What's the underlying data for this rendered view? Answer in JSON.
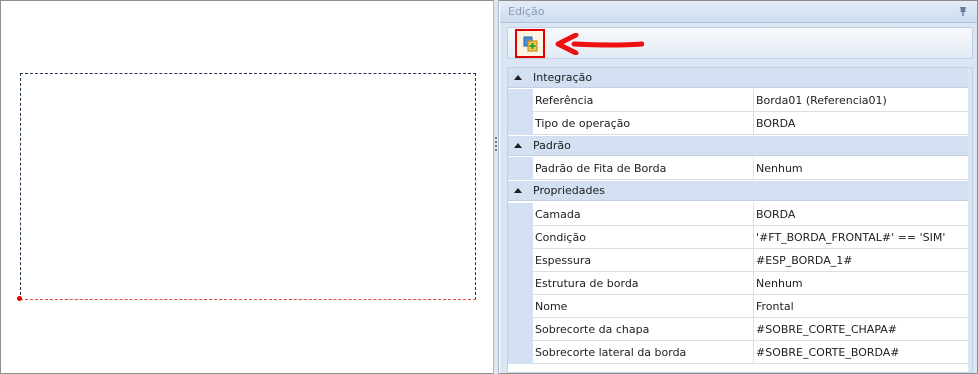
{
  "panel": {
    "title": "Edição",
    "pin_icon": "pin-icon",
    "toolbar": {
      "add_icon": "add-layer-icon"
    }
  },
  "colors": {
    "highlight": "#e00000",
    "category_bg": "#d3e0f1",
    "panel_bg": "#dbe6f4",
    "rect_outline": "#1f3550"
  },
  "properties": {
    "categories": [
      {
        "label": "Integração",
        "rows": [
          {
            "name": "Referência",
            "value": "Borda01 (Referencia01)"
          },
          {
            "name": "Tipo de operação",
            "value": "BORDA"
          }
        ]
      },
      {
        "label": "Padrão",
        "rows": [
          {
            "name": "Padrão de Fita de Borda",
            "value": "Nenhum"
          }
        ]
      },
      {
        "label": "Propriedades",
        "rows": [
          {
            "name": "Camada",
            "value": "BORDA"
          },
          {
            "name": "Condição",
            "value": "'#FT_BORDA_FRONTAL#' == 'SIM'"
          },
          {
            "name": "Espessura",
            "value": "#ESP_BORDA_1#"
          },
          {
            "name": "Estrutura de borda",
            "value": "Nenhum"
          },
          {
            "name": "Nome",
            "value": "Frontal"
          },
          {
            "name": "Sobrecorte da chapa",
            "value": "#SOBRE_CORTE_CHAPA#"
          },
          {
            "name": "Sobrecorte lateral da borda",
            "value": "#SOBRE_CORTE_BORDA#"
          }
        ]
      }
    ]
  }
}
